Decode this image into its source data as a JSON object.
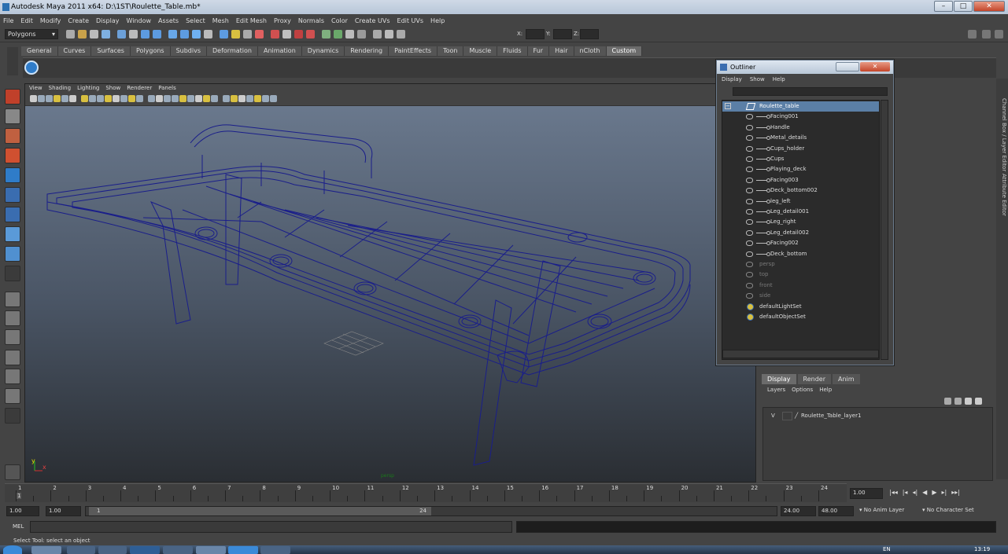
{
  "window": {
    "title": "Autodesk Maya 2011 x64: D:\\1ST\\Roulette_Table.mb*"
  },
  "menubar": [
    "File",
    "Edit",
    "Modify",
    "Create",
    "Display",
    "Window",
    "Assets",
    "Select",
    "Mesh",
    "Edit Mesh",
    "Proxy",
    "Normals",
    "Color",
    "Create UVs",
    "Edit UVs",
    "Help"
  ],
  "statusline": {
    "mode": "Polygons",
    "x_label": "X:",
    "y_label": "Y:",
    "z_label": "Z:"
  },
  "shelf_tabs": [
    "General",
    "Curves",
    "Surfaces",
    "Polygons",
    "Subdivs",
    "Deformation",
    "Animation",
    "Dynamics",
    "Rendering",
    "PaintEffects",
    "Toon",
    "Muscle",
    "Fluids",
    "Fur",
    "Hair",
    "nCloth",
    "Custom"
  ],
  "active_shelf": "Custom",
  "viewport": {
    "menu": [
      "View",
      "Shading",
      "Lighting",
      "Show",
      "Renderer",
      "Panels"
    ],
    "camera_label": "persp",
    "axis_y": "y",
    "axis_x": "x"
  },
  "outliner": {
    "title": "Outliner",
    "menu": [
      "Display",
      "Show",
      "Help"
    ],
    "root": "Roulette_table",
    "children": [
      "Facing001",
      "Handle",
      "Metal_details",
      "Cups_holder",
      "Cups",
      "Playing_deck",
      "Facing003",
      "Deck_bottom002",
      "leg_left",
      "Leg_detail001",
      "Leg_right",
      "Leg_detail002",
      "Facing002",
      "Deck_bottom"
    ],
    "cameras": [
      "persp",
      "top",
      "front",
      "side"
    ],
    "sets": [
      "defaultLightSet",
      "defaultObjectSet"
    ]
  },
  "side_tabs": [
    "Channel Box / Layer Editor",
    "Attribute Editor"
  ],
  "layer_editor": {
    "tabs": [
      "Display",
      "Render",
      "Anim"
    ],
    "active_tab": "Display",
    "menu": [
      "Layers",
      "Options",
      "Help"
    ],
    "layer_visible": "V",
    "layer_name": "Roulette_Table_layer1"
  },
  "timeline": {
    "ticks": [
      "1",
      "2",
      "3",
      "4",
      "5",
      "6",
      "7",
      "8",
      "9",
      "10",
      "11",
      "12",
      "13",
      "14",
      "15",
      "16",
      "17",
      "18",
      "19",
      "20",
      "21",
      "22",
      "23",
      "24"
    ],
    "current_frame": "1",
    "current_time": "1.00"
  },
  "range": {
    "start": "1.00",
    "playback_start": "1.00",
    "slider_start": "1",
    "slider_end": "24",
    "playback_end": "24.00",
    "end": "48.00",
    "anim_layer": "No Anim Layer",
    "char_set": "No Character Set"
  },
  "mel": {
    "label": "MEL"
  },
  "help_line": "Select Tool: select an object",
  "taskbar": {
    "lang": "EN",
    "clock": "13:19"
  }
}
